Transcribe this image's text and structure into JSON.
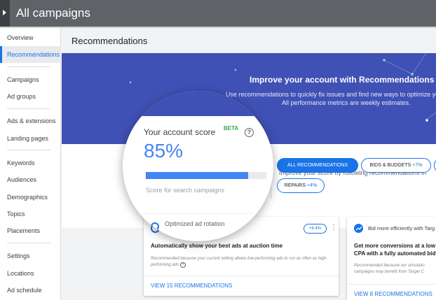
{
  "header": {
    "title": "All campaigns"
  },
  "sidebar": {
    "items": [
      {
        "label": "Overview",
        "active": false
      },
      {
        "label": "Recommendations",
        "active": true
      },
      {
        "label": "Campaigns",
        "active": false
      },
      {
        "label": "Ad groups",
        "active": false
      },
      {
        "label": "Ads & extensions",
        "active": false
      },
      {
        "label": "Landing pages",
        "active": false
      },
      {
        "label": "Keywords",
        "active": false
      },
      {
        "label": "Audiences",
        "active": false
      },
      {
        "label": "Demographics",
        "active": false
      },
      {
        "label": "Topics",
        "active": false
      },
      {
        "label": "Placements",
        "active": false
      },
      {
        "label": "Settings",
        "active": false
      },
      {
        "label": "Locations",
        "active": false
      },
      {
        "label": "Ad schedule",
        "active": false
      }
    ]
  },
  "main": {
    "page_title": "Recommendations",
    "hero": {
      "headline": "Improve your account with Recommendations",
      "subtext_1": "Use recommendations to quickly fix issues and find new ways to optimize your",
      "subtext_2": "All performance metrics are weekly estimates."
    },
    "score_panel": {
      "title": "Your account score",
      "beta": "BETA",
      "help": "?",
      "score": "85%",
      "score_fraction": 0.85,
      "caption": "Score for search campaigns"
    },
    "improve_text": "Improve your score by following recommendations in",
    "filters": [
      {
        "label": "ALL RECOMMENDATIONS",
        "delta": ""
      },
      {
        "label": "BIDS & BUDGETS",
        "delta": "+7%"
      },
      {
        "label": "REPAIRS",
        "delta": "+4%"
      }
    ],
    "cards": [
      {
        "header": "Optimized ad rotation",
        "badge": "+6.4%",
        "title": "Automatically show your best ads at auction time",
        "note": "Recommended because your current setting allows low-performing ads to run as often as high-performing ads",
        "note_help": "?",
        "link": "VIEW 15 RECOMMENDATIONS"
      },
      {
        "header": "Bid more efficiently with Targ",
        "title_1": "Get more conversions at a low",
        "title_2": "CPA with a fully automated bid",
        "note_1": "Recommended because our simulatio",
        "note_2": "campaigns may benefit from Target C",
        "link": "VIEW 8 RECOMMENDATIONS"
      }
    ]
  },
  "colors": {
    "accent": "#1a73e8",
    "hero_bg": "#3f51b5",
    "beta": "#34a853",
    "topbar": "#5f6368"
  }
}
